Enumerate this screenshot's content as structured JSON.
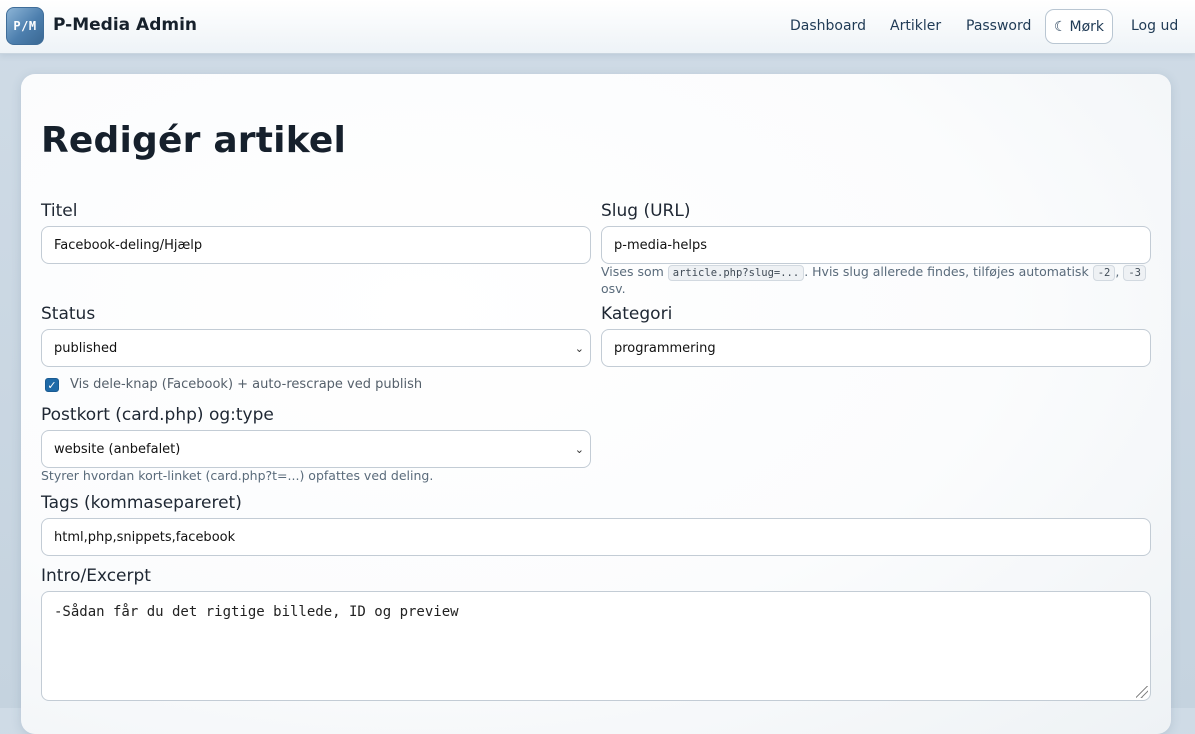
{
  "header": {
    "logo_text": "P/M",
    "brand": "P-Media Admin",
    "nav": {
      "dashboard": "Dashboard",
      "artikler": "Artikler",
      "password": "Password",
      "theme_icon": "☾",
      "theme_label": "Mørk",
      "logout": "Log ud"
    }
  },
  "page": {
    "title": "Redigér artikel"
  },
  "form": {
    "title_label": "Titel",
    "title_value": "Facebook-deling/Hjælp",
    "slug_label": "Slug (URL)",
    "slug_value": "p-media-helps",
    "slug_help": {
      "prefix": "Vises som",
      "code_example": "article.php?slug=...",
      "middle": ". Hvis slug allerede findes, tilføjes automatisk",
      "code_suffix_1": "-2",
      "comma": ",",
      "code_suffix_2": "-3",
      "end": "osv."
    },
    "status_label": "Status",
    "status_value": "published",
    "category_label": "Kategori",
    "category_value": "programmering",
    "share_checkbox_label": "Vis dele-knap (Facebook) + auto-rescrape ved publish",
    "share_checkbox_checked": true,
    "ogtype_label": "Postkort (card.php) og:type",
    "ogtype_value": "website (anbefalet)",
    "ogtype_help": "Styrer hvordan kort-linket (card.php?t=...) opfattes ved deling.",
    "tags_label": "Tags (kommasepareret)",
    "tags_value": "html,php,snippets,facebook",
    "intro_label": "Intro/Excerpt",
    "intro_value": "-Sådan får du det rigtige billede, ID og preview"
  },
  "icons": {
    "checkbox_check": "✓",
    "select_chevron": "⌄",
    "theme_moon": "moon-icon"
  },
  "colors": {
    "accent": "#1f6aa8",
    "nav_text": "#1f3a55",
    "background": "#c5d3df"
  }
}
